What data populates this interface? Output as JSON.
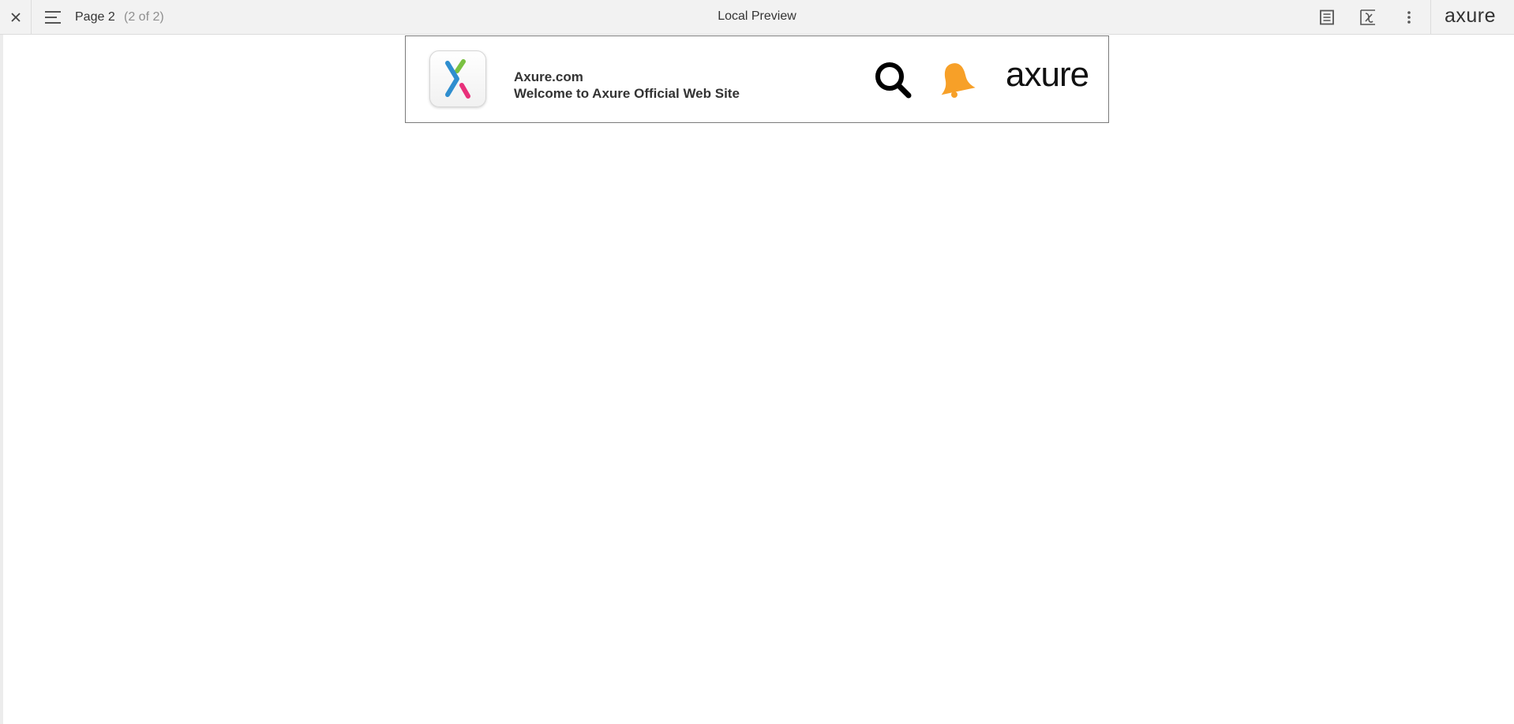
{
  "toolbar": {
    "close_icon": "close-icon",
    "menu_icon": "hamburger-menu-icon",
    "page_name": "Page 2",
    "page_count": "(2 of 2)",
    "title": "Local Preview",
    "buttons": [
      {
        "name": "notes-button",
        "icon": "document-lines-icon"
      },
      {
        "name": "variables-button",
        "icon": "function-x-icon"
      },
      {
        "name": "more-options-button",
        "icon": "vertical-dots-icon"
      }
    ],
    "logo_text": "axure"
  },
  "header": {
    "app_icon": "axure-x-logo-icon",
    "site_name": "Axure.com",
    "tagline": "Welcome to Axure Official Web Site",
    "search_icon": "search-icon",
    "bell_icon": "bell-icon",
    "brand_logo": "axure"
  },
  "colors": {
    "toolbar_bg": "#f2f2f2",
    "bell": "#f7a028",
    "logo_green": "#7ac142",
    "logo_blue": "#2f8ecf",
    "logo_pink": "#e8307a",
    "text": "#333333"
  }
}
